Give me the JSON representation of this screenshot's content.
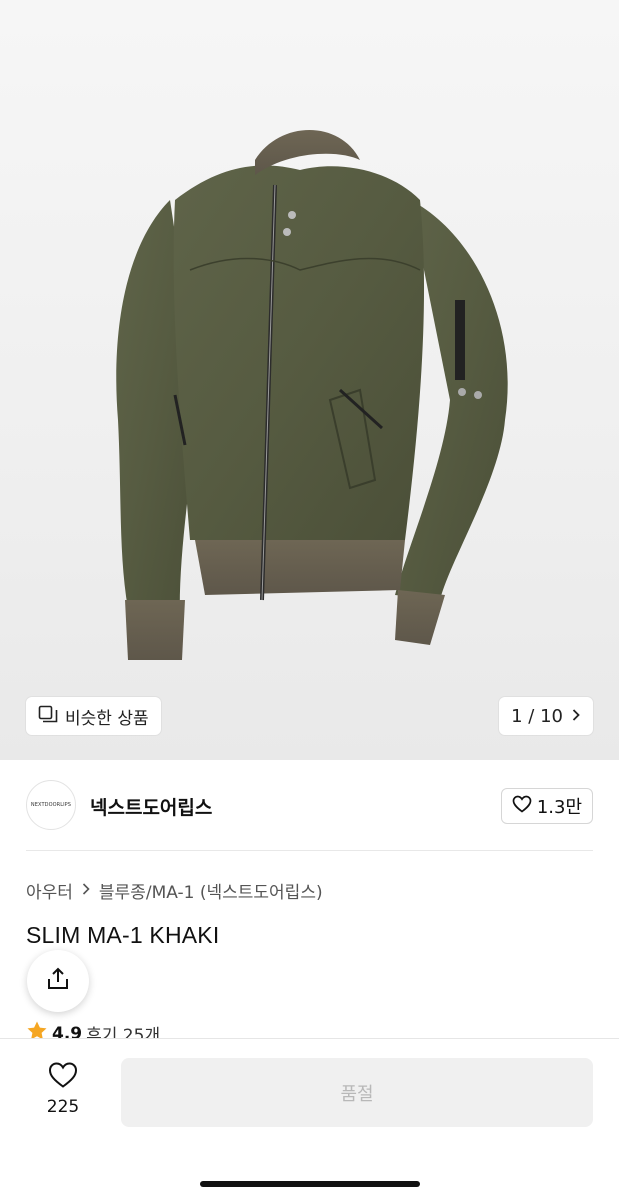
{
  "product_image": {
    "similar_products_label": "비슷한 상품",
    "page_indicator": "1 / 10",
    "icons": [
      "similar-items-icon",
      "chevron-right-icon"
    ]
  },
  "brand": {
    "logo_text": "NEXTDOORLIPS",
    "name": "넥스트도어립스",
    "like_count": "1.3만"
  },
  "breadcrumb": {
    "category": "아우터",
    "subcategory": "블루종/MA-1 (넥스트도어립스)"
  },
  "product": {
    "title": "SLIM MA-1 KHAKI",
    "rating_score": "4.9",
    "review_label": "후기 25개"
  },
  "bottom_bar": {
    "wish_count": "225",
    "buy_button_label": "품절"
  },
  "colors": {
    "jacket": "#5b6046",
    "star": "#f5a623",
    "soldout_bg": "#f0f0f0"
  }
}
